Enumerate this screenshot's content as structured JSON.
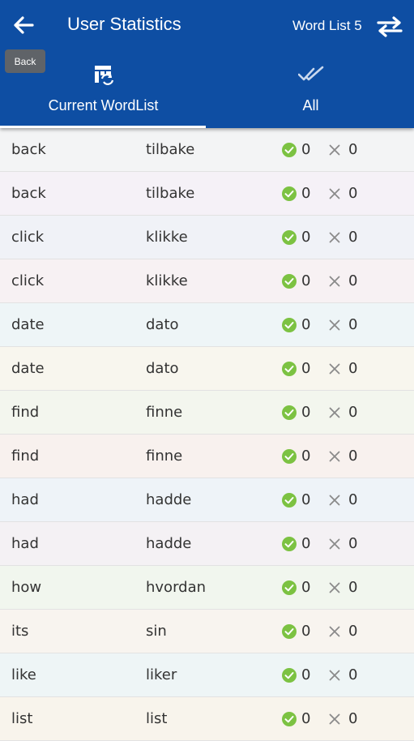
{
  "header": {
    "title": "User Statistics",
    "word_list": "Word List 5",
    "back_tooltip": "Back",
    "back_icon": "arrow-left",
    "swap_icon": "swap-arrows"
  },
  "tabs": [
    {
      "label": "Current WordList",
      "icon": "wordlist-refresh",
      "selected": true
    },
    {
      "label": "All",
      "icon": "double-check",
      "selected": false
    }
  ],
  "colors": {
    "appbar": "#0e4ea3",
    "check": "#7cc242",
    "cross": "#8a8a8a"
  },
  "rows": [
    {
      "word": "back",
      "translation": "tilbake",
      "correct": "0",
      "wrong": "0",
      "bg": "#f3f4f5"
    },
    {
      "word": "back",
      "translation": "tilbake",
      "correct": "0",
      "wrong": "0",
      "bg": "#f5f1f7"
    },
    {
      "word": "click",
      "translation": "klikke",
      "correct": "0",
      "wrong": "0",
      "bg": "#f0f2f7"
    },
    {
      "word": "click",
      "translation": "klikke",
      "correct": "0",
      "wrong": "0",
      "bg": "#f7f1f3"
    },
    {
      "word": "date",
      "translation": "dato",
      "correct": "0",
      "wrong": "0",
      "bg": "#eef5f7"
    },
    {
      "word": "date",
      "translation": "dato",
      "correct": "0",
      "wrong": "0",
      "bg": "#f8f6ee"
    },
    {
      "word": "find",
      "translation": "finne",
      "correct": "0",
      "wrong": "0",
      "bg": "#f3f6ee"
    },
    {
      "word": "find",
      "translation": "finne",
      "correct": "0",
      "wrong": "0",
      "bg": "#f8f1ee"
    },
    {
      "word": "had",
      "translation": "hadde",
      "correct": "0",
      "wrong": "0",
      "bg": "#eef3f8"
    },
    {
      "word": "had",
      "translation": "hadde",
      "correct": "0",
      "wrong": "0",
      "bg": "#f4f1f4"
    },
    {
      "word": "how",
      "translation": "hvordan",
      "correct": "0",
      "wrong": "0",
      "bg": "#f1f6ee"
    },
    {
      "word": "its",
      "translation": "sin",
      "correct": "0",
      "wrong": "0",
      "bg": "#f8f4ef"
    },
    {
      "word": "like",
      "translation": "liker",
      "correct": "0",
      "wrong": "0",
      "bg": "#eef5f6"
    },
    {
      "word": "list",
      "translation": "list",
      "correct": "0",
      "wrong": "0",
      "bg": "#f8f4ec"
    }
  ]
}
